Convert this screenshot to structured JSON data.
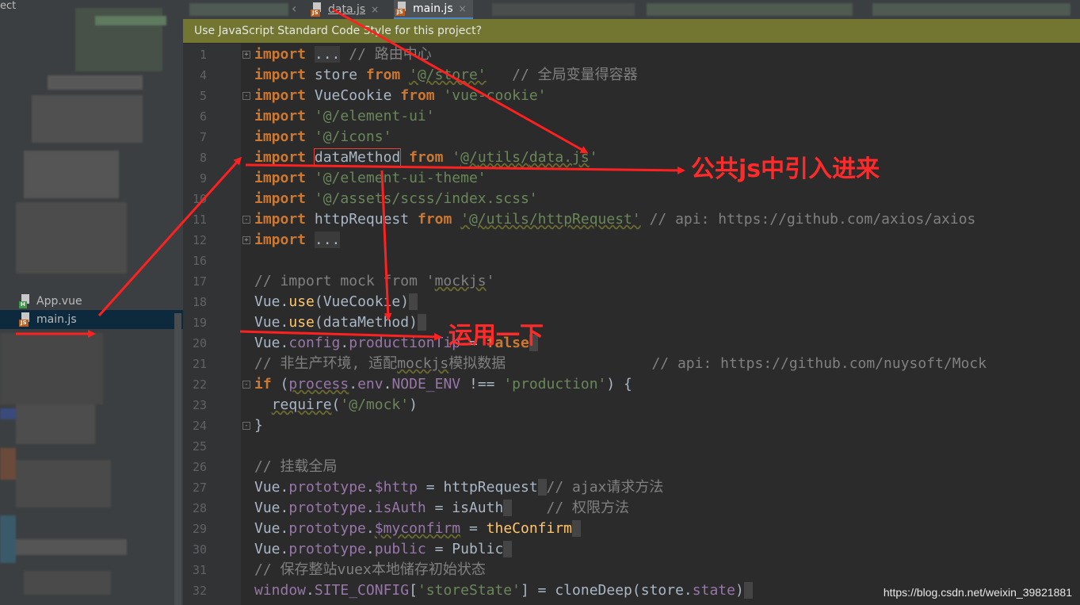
{
  "sidebar": {
    "project_label": "ect",
    "files": [
      {
        "name": "App.vue",
        "type": "vue"
      },
      {
        "name": "main.js",
        "type": "js"
      }
    ]
  },
  "tabs": [
    {
      "name": "data.js",
      "type": "js"
    },
    {
      "name": "main.js",
      "type": "js",
      "active": true
    }
  ],
  "tab_close": "×",
  "tab_prev": "‹",
  "notification": "Use JavaScript Standard Code Style for this project?",
  "editor": {
    "line_numbers": [
      "1",
      "4",
      "5",
      "6",
      "7",
      "8",
      "9",
      "10",
      "11",
      "12",
      "16",
      "17",
      "18",
      "19",
      "20",
      "21",
      "22",
      "23",
      "24",
      "25",
      "26",
      "27",
      "28",
      "29",
      "30",
      "31",
      "32"
    ],
    "t": {
      "import": "import",
      "from": "from",
      "dots": "...",
      "c_router": "// 路由中心",
      "store": "store",
      "s_store": "'@/store'",
      "c_store": "// 全局变量得容器",
      "vuecookie": "VueCookie",
      "s_vuecookie": "'vue-cookie'",
      "s_elementui": "'@/element-ui'",
      "s_icons": "'@/icons'",
      "datamethod": "dataMethod",
      "s_q": "'",
      "s_utils_a": "@/",
      "s_utils_b": "utils",
      "s_slash": "/",
      "s_datajs": "data.js",
      "s_theme": "'@/element-ui-theme'",
      "s_scss": "'@/assets/scss/index.scss'",
      "httprequest": "httpRequest",
      "s_httprequest_a": "'@/",
      "s_httprequest_b": "utils/httpRequest'",
      "c_axios": "// api: https://github.com/axios/axios",
      "c_mock_a": "// import mock from '",
      "c_mock_b": "mockjs",
      "vue": "Vue",
      "dot": ".",
      "use": "use",
      "lp": "(",
      "rp": ")",
      "eq": " = ",
      "config": "config",
      "productiontip": "productionTip",
      "false": "false",
      "c_mock2_a": "// 非生产环境, 适配",
      "c_mock2_b": "mockjs",
      "c_mock2_c": "模拟数据",
      "c_mock2_d": "// api: https://github.com/nuysoft/Mock",
      "if": "if",
      "process": "process",
      "env": "env",
      "node_env": "NODE_ENV",
      "neq": " !== ",
      "s_production": "'production'",
      "lbrace": ") {",
      "require": "require",
      "s_mock": "'@/mock'",
      "rbrace": "}",
      "c_global": "// 挂载全局",
      "prototype": "prototype",
      "http": "$http",
      "c_ajax": "// ajax请求方法",
      "isauth": "isAuth",
      "c_auth": "// 权限方法",
      "myconfirm": "$myconfirm",
      "theconfirm": "theConfirm",
      "public": "public",
      "Public": "Public",
      "c_save": "// 保存整站vuex本地储存初始状态",
      "window": "window",
      "site_config": "SITE_CONFIG",
      "lb": "[",
      "rb": "]",
      "s_storestate": "'storeState'",
      "clonedeep": "cloneDeep",
      "state": "state"
    }
  },
  "annotations": {
    "common_js": "公共js中引入进来",
    "use_it": "运用一下",
    "arrow_color": "#ff2020"
  },
  "watermark": "https://blog.csdn.net/weixin_39821881"
}
